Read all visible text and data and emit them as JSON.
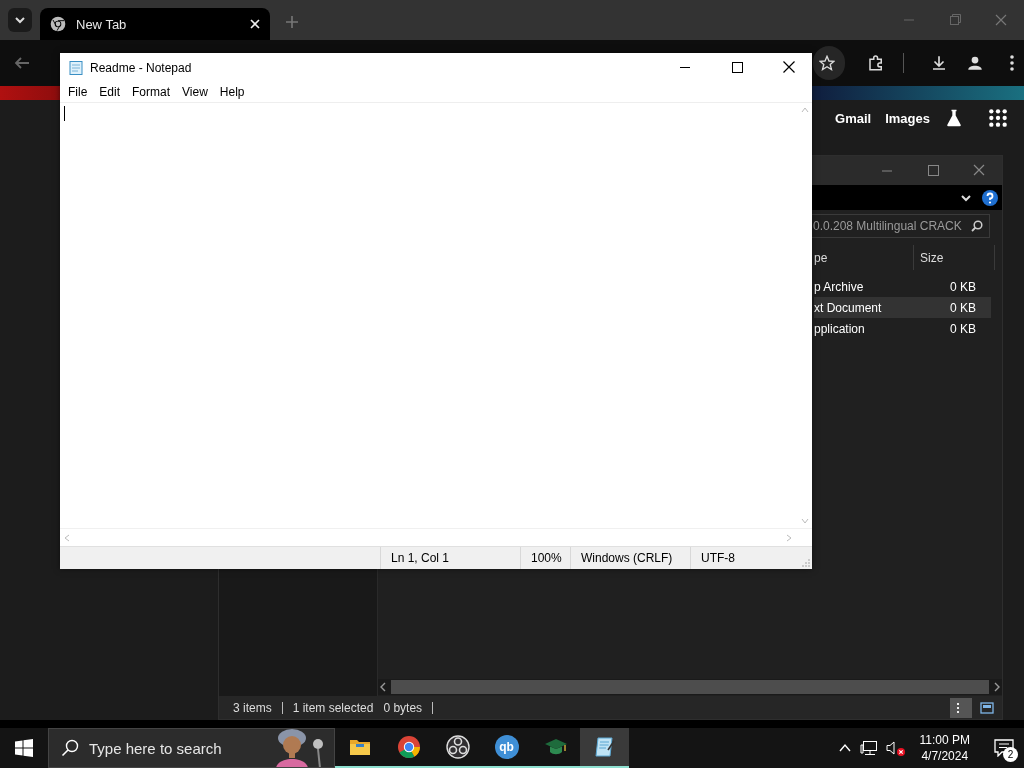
{
  "browser": {
    "tabs": [
      {
        "label": "New Tab",
        "selected": true
      }
    ],
    "links": [
      "Gmail",
      "Images"
    ]
  },
  "explorer": {
    "search_value": "0.0.208 Multilingual CRACK",
    "columns": [
      "pe",
      "Size"
    ],
    "rows": [
      {
        "type": "p Archive",
        "size": "0 KB",
        "selected": false
      },
      {
        "type": "xt Document",
        "size": "0 KB",
        "selected": true
      },
      {
        "type": "pplication",
        "size": "0 KB",
        "selected": false
      }
    ],
    "status": {
      "count": "3 items",
      "selection": "1 item selected",
      "size": "0 bytes"
    },
    "view_buttons": [
      {
        "kind": "details",
        "selected": true
      },
      {
        "kind": "tiles",
        "selected": false
      }
    ]
  },
  "notepad": {
    "title": "Readme - Notepad",
    "menu": [
      "File",
      "Edit",
      "Format",
      "View",
      "Help"
    ],
    "status": {
      "position": "Ln 1, Col 1",
      "zoom": "100%",
      "line_endings": "Windows (CRLF)",
      "encoding": "UTF-8"
    }
  },
  "taskbar": {
    "search_placeholder": "Type here to search",
    "apps": [
      {
        "kind": "folder",
        "running": true,
        "selected": false
      },
      {
        "kind": "chrome",
        "running": true,
        "selected": false
      },
      {
        "kind": "obs",
        "running": true,
        "selected": false
      },
      {
        "kind": "torrent",
        "label": "qb",
        "running": true,
        "selected": false
      },
      {
        "kind": "cap",
        "running": true,
        "selected": false
      },
      {
        "kind": "notepad",
        "running": true,
        "selected": true
      }
    ],
    "volume_muted": true,
    "time": "11:00 PM",
    "date": "4/7/2024",
    "notifications": "2"
  }
}
